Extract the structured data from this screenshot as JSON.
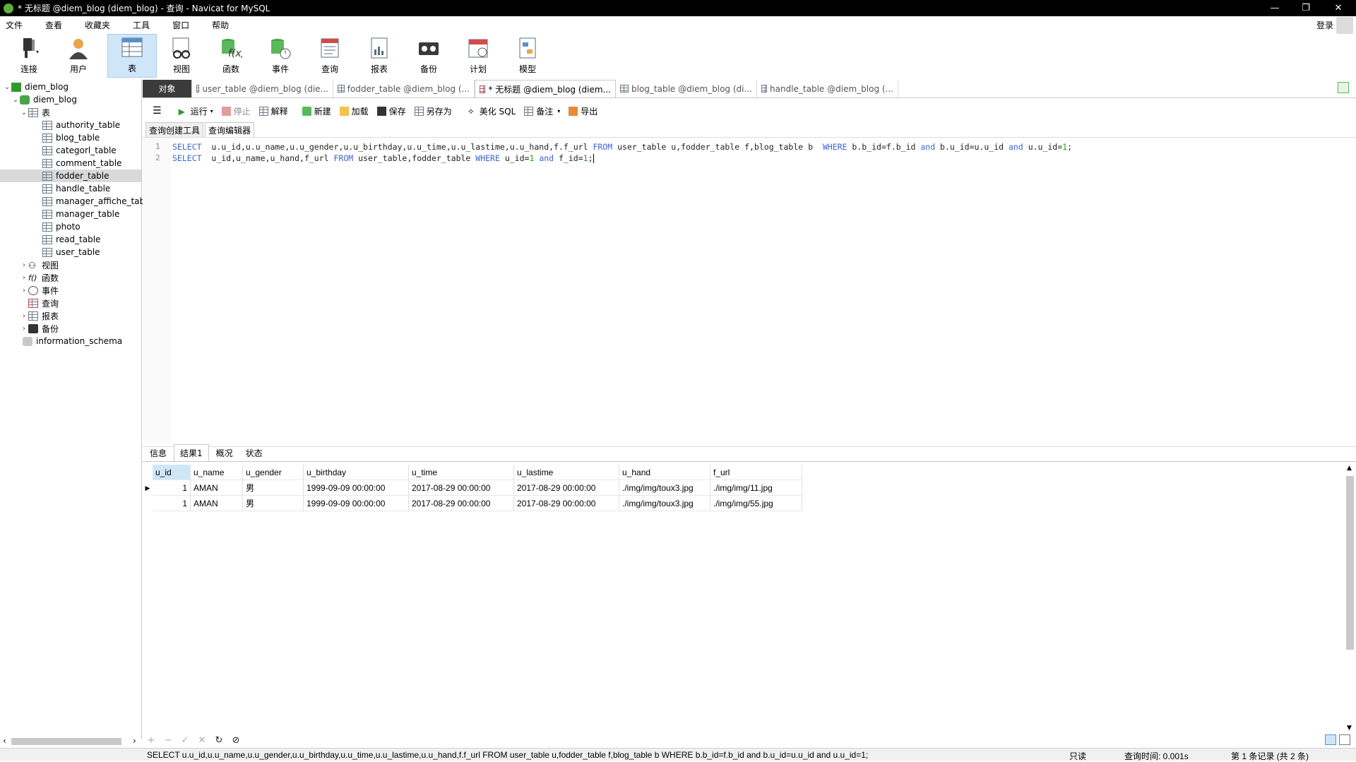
{
  "window": {
    "title": "* 无标题 @diem_blog (diem_blog) - 查询 - Navicat for MySQL",
    "controls": [
      "—",
      "❐",
      "✕"
    ]
  },
  "menu": [
    "文件",
    "查看",
    "收藏夹",
    "工具",
    "窗口",
    "帮助"
  ],
  "account": {
    "login_label": "登录"
  },
  "toolbar": [
    {
      "label": "连接",
      "icon": "plug-icon"
    },
    {
      "label": "用户",
      "icon": "user-icon"
    },
    {
      "label": "表",
      "icon": "table-icon"
    },
    {
      "label": "视图",
      "icon": "view-icon"
    },
    {
      "label": "函数",
      "icon": "function-icon"
    },
    {
      "label": "事件",
      "icon": "event-icon"
    },
    {
      "label": "查询",
      "icon": "query-icon"
    },
    {
      "label": "报表",
      "icon": "report-icon"
    },
    {
      "label": "备份",
      "icon": "backup-icon"
    },
    {
      "label": "计划",
      "icon": "calendar-icon"
    },
    {
      "label": "模型",
      "icon": "model-icon"
    }
  ],
  "sidebar": {
    "connection": "diem_blog",
    "database": "diem_blog",
    "tables_label": "表",
    "tables": [
      "authority_table",
      "blog_table",
      "categorl_table",
      "comment_table",
      "fodder_table",
      "handle_table",
      "manager_affiche_tab",
      "manager_table",
      "photo",
      "read_table",
      "user_table"
    ],
    "selected_table": "fodder_table",
    "groups": [
      "视图",
      "函数",
      "事件",
      "查询",
      "报表",
      "备份"
    ],
    "other_db": "information_schema"
  },
  "tabs": {
    "object": "对象",
    "items": [
      "user_table @diem_blog (die...",
      "fodder_table @diem_blog (...",
      "* 无标题 @diem_blog (diem...",
      "blog_table @diem_blog (di...",
      "handle_table @diem_blog (..."
    ]
  },
  "query_toolbar": {
    "run": "运行",
    "stop": "停止",
    "explain": "解释",
    "new": "新建",
    "load": "加载",
    "save": "保存",
    "save_as": "另存为",
    "beautify": "美化 SQL",
    "note": "备注",
    "export": "导出"
  },
  "editor_tabs": [
    "查询创建工具",
    "查询编辑器"
  ],
  "editor": {
    "line_numbers": [
      "1",
      "2"
    ],
    "line1": {
      "k1": "SELECT",
      "t1": "  u.u_id,u.u_name,u.u_gender,u.u_birthday,u.u_time,u.u_lastime,u.u_hand,f.f_url ",
      "k2": "FROM",
      "t2": " user_table u,fodder_table f,blog_table b  ",
      "k3": "WHERE",
      "t3": " b.b_id=f.b_id ",
      "k4": "and",
      "t4": " b.u_id=u.u_id ",
      "k5": "and",
      "t5": " u.u_id=",
      "n1": "1",
      "t6": ";"
    },
    "line2": {
      "k1": "SELECT",
      "t1": "  u_id,u_name,u_hand,f_url ",
      "k2": "FROM",
      "t2": " user_table,fodder_table ",
      "k3": "WHERE",
      "t3": " u_id=",
      "n1": "1",
      "t4": " ",
      "k4": "and",
      "t5": " f_id=",
      "n2": "1",
      "t6": ";"
    }
  },
  "result_tabs": [
    "信息",
    "结果1",
    "概况",
    "状态"
  ],
  "result": {
    "columns": [
      "u_id",
      "u_name",
      "u_gender",
      "u_birthday",
      "u_time",
      "u_lastime",
      "u_hand",
      "f_url"
    ],
    "rows": [
      [
        "1",
        "AMAN",
        "男",
        "1999-09-09 00:00:00",
        "2017-08-29 00:00:00",
        "2017-08-29 00:00:00",
        "./img/img/toux3.jpg",
        "./img/img/11.jpg"
      ],
      [
        "1",
        "AMAN",
        "男",
        "1999-09-09 00:00:00",
        "2017-08-29 00:00:00",
        "2017-08-29 00:00:00",
        "./img/img/toux3.jpg",
        "./img/img/55.jpg"
      ]
    ]
  },
  "grid_buttons": [
    "+",
    "−",
    "✓",
    "✕",
    "↻",
    "⊘"
  ],
  "status": {
    "sql": "SELECT  u.u_id,u.u_name,u.u_gender,u.u_birthday,u.u_time,u.u_lastime,u.u_hand,f.f_url FROM user_table u,fodder_table f,blog_table b  WHERE b.b_id=f.b_id and b.u_id=u.u_id and u.u_id=1;",
    "readonly": "只读",
    "query_time": "查询时间: 0.001s",
    "record": "第 1 条记录 (共 2 条)"
  }
}
